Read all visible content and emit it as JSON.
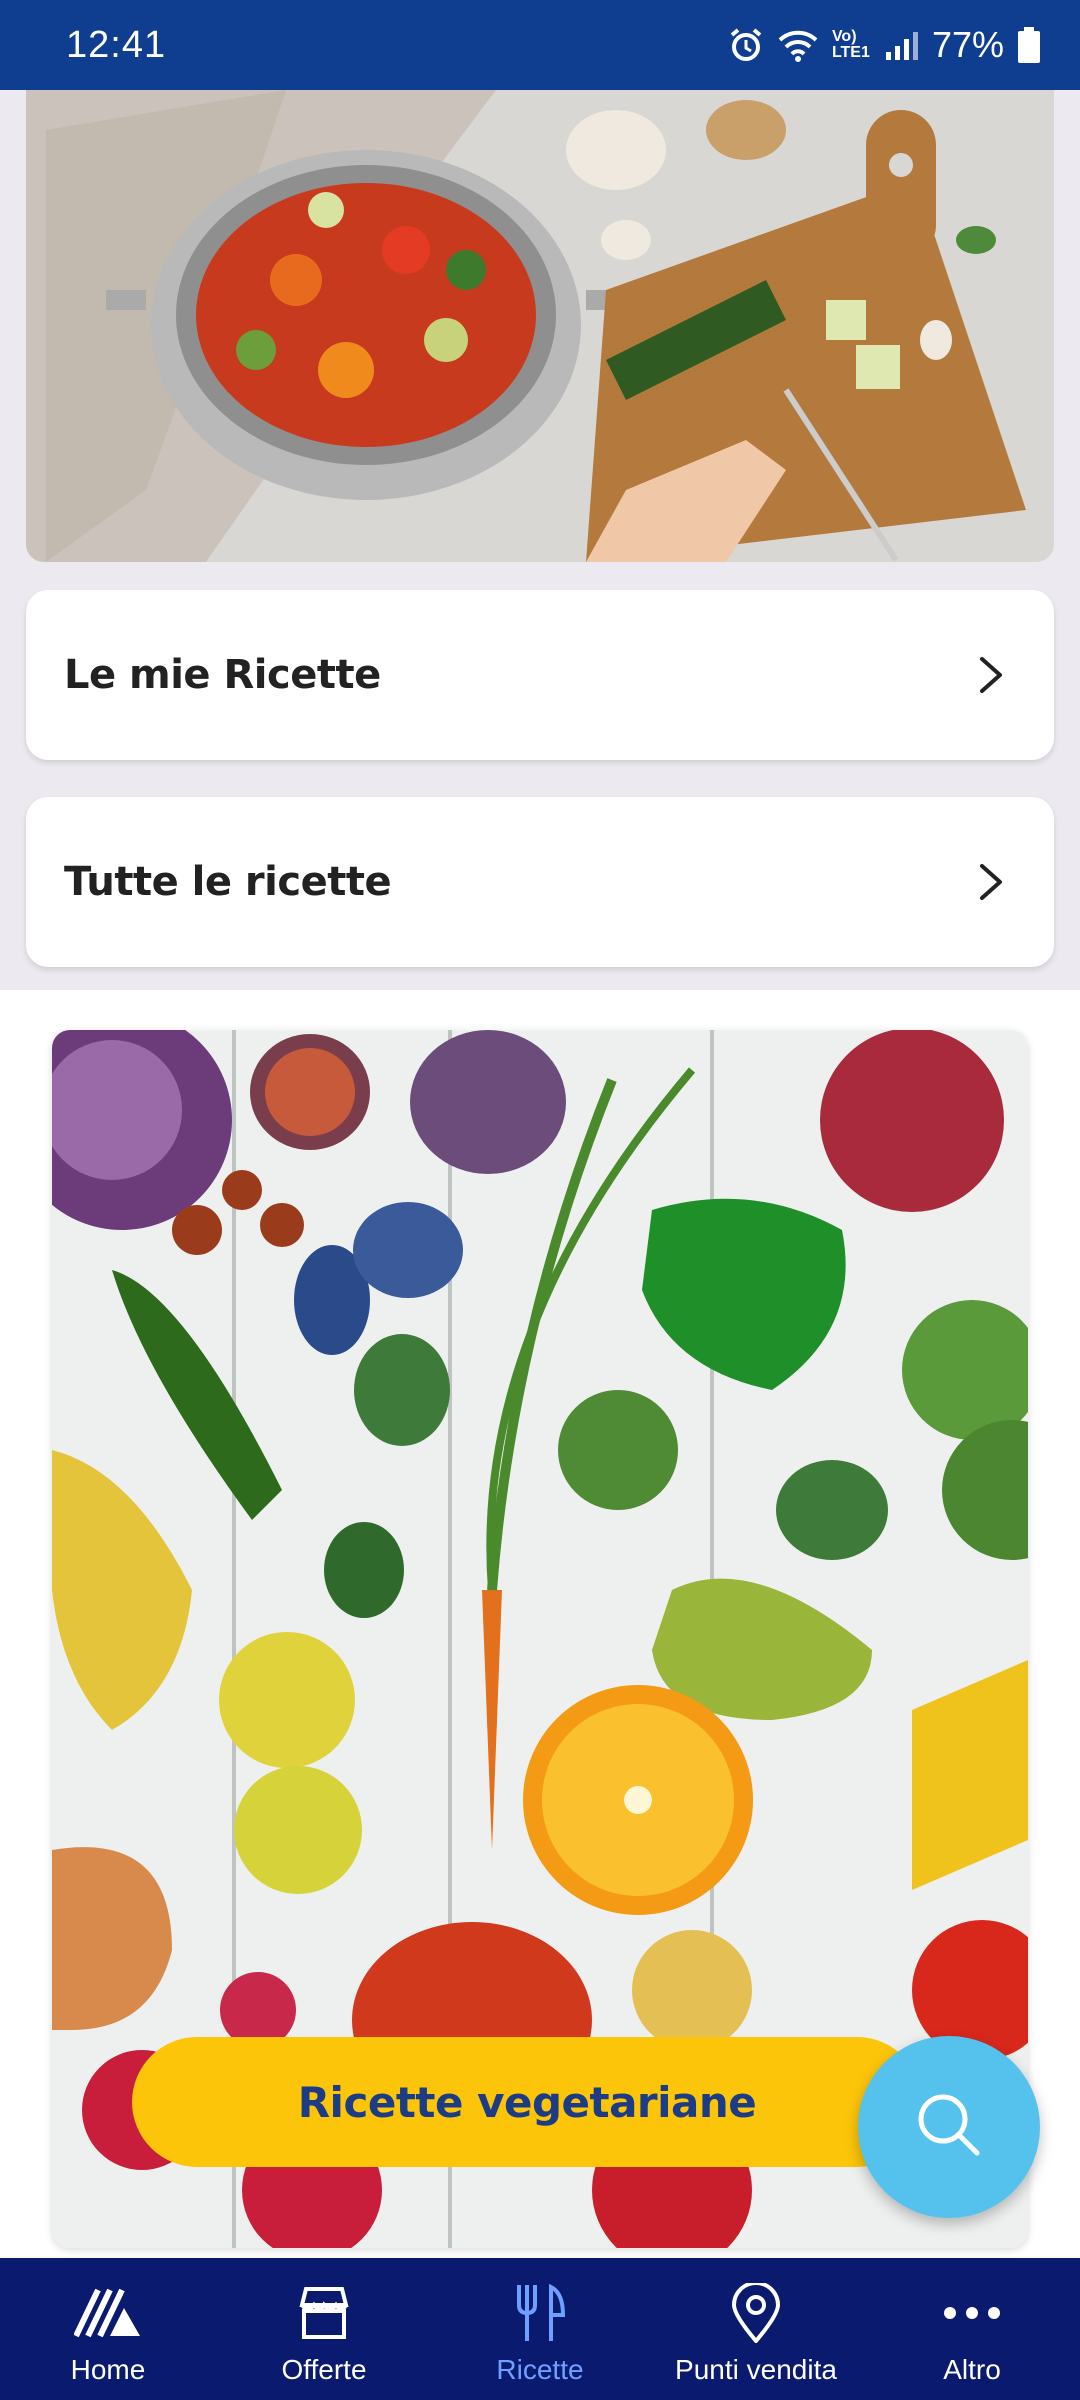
{
  "status_bar": {
    "time": "12:41",
    "network": "Vo) LTE1",
    "battery": "77%"
  },
  "menu": {
    "my_recipes": "Le mie Ricette",
    "all_recipes": "Tutte le ricette"
  },
  "promo": {
    "button_label": "Ricette vegetariane"
  },
  "nav": {
    "home": "Home",
    "offers": "Offerte",
    "recipes": "Ricette",
    "stores": "Punti vendita",
    "more": "Altro"
  },
  "colors": {
    "brand_blue": "#0f3d8f",
    "nav_blue": "#0a1a6e",
    "accent_yellow": "#fdc50a",
    "fab_blue": "#55c2ee",
    "active_nav": "#6fa0ff"
  }
}
